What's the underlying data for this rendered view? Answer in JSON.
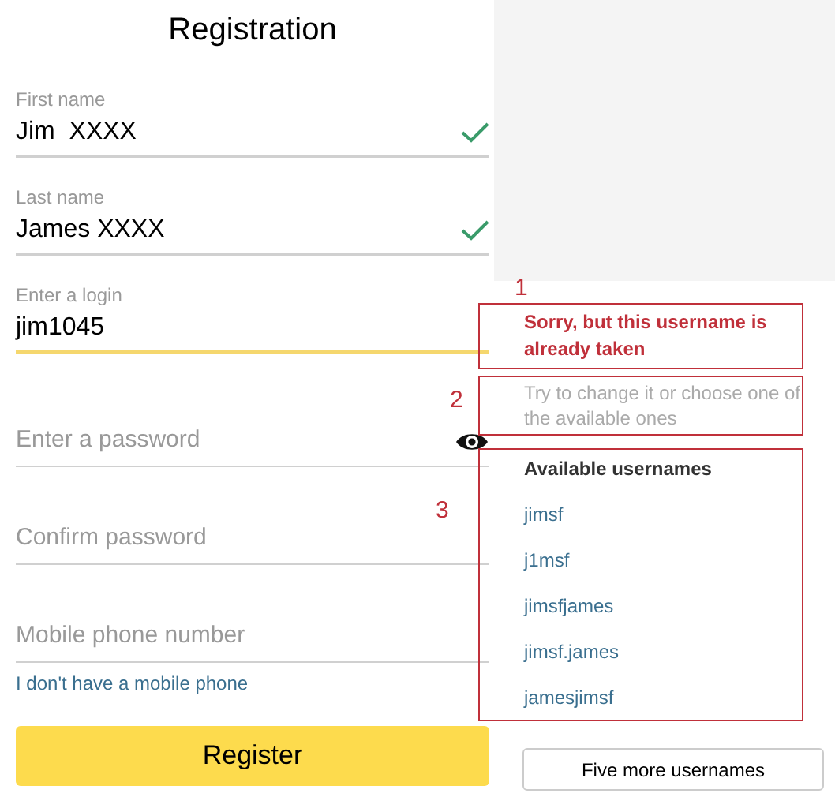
{
  "title": "Registration",
  "fields": [
    {
      "label": "First name",
      "value": "Jim  XXXX",
      "valid": true,
      "focused": false
    },
    {
      "label": "Last name",
      "value": "James XXXX",
      "valid": true,
      "focused": false
    },
    {
      "label": "Enter a login",
      "value": "jim1045",
      "valid": false,
      "focused": true
    },
    {
      "placeholder": "Enter a password",
      "kind": "password"
    },
    {
      "placeholder": "Confirm password",
      "kind": "plain"
    },
    {
      "placeholder": "Mobile phone number",
      "kind": "plain"
    }
  ],
  "no_phone_link": "I don't have a mobile phone",
  "register_button": "Register",
  "popup": {
    "error": "Sorry, but this username is already taken",
    "hint": "Try to change it or choose one of the available ones",
    "available_heading": "Available usernames",
    "usernames": [
      "jimsf",
      "j1msf",
      "jimsfjames",
      "jimsf.james",
      "jamesjimsf"
    ],
    "more_button": "Five more usernames"
  },
  "annotations": [
    "1",
    "2",
    "3"
  ]
}
